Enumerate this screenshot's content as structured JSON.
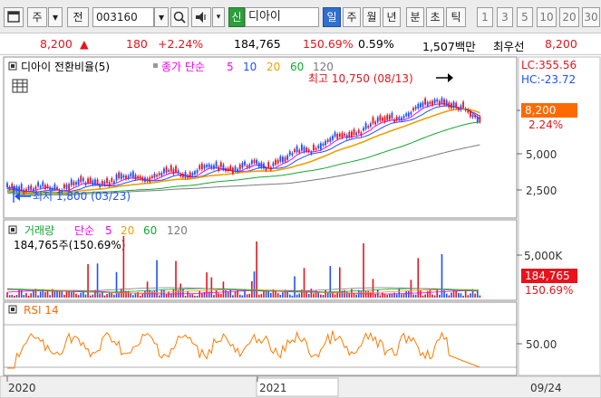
{
  "toolbar": {
    "period": "주",
    "type_label": "전",
    "code": "003160",
    "market_badge": "신",
    "stock_name": "디아이",
    "period_tabs": [
      "일",
      "주",
      "월",
      "년",
      "분",
      "초",
      "틱"
    ],
    "active_tab": "일",
    "num_tabs": [
      "1",
      "3",
      "5",
      "10",
      "20",
      "30"
    ]
  },
  "quote": {
    "price": "8,200",
    "direction": "▲",
    "change": "180",
    "change_pct": "+2.24%",
    "volume": "184,765",
    "volume_ratio": "150.69%",
    "turnover": "0.59%",
    "amount": "1,507백만",
    "tag": "최우선",
    "tag_price": "8,200"
  },
  "price_panel": {
    "title": "디아이 전환비율(5)",
    "ma_label": "종가 단순",
    "ma_periods": [
      "5",
      "10",
      "20",
      "60",
      "120"
    ],
    "ma_colors": [
      "#ff00ff",
      "#1e4fff",
      "#f0a000",
      "#12a830",
      "#7a7a7a"
    ],
    "lc": "LC:355.56",
    "hc": "HC:-23.72",
    "price_tag": "8,200",
    "pct_tag": "2.24%",
    "axis_ticks": [
      "5,000",
      "2,500"
    ],
    "high_note": "최고 10,750 (08/13)",
    "low_note": "최저 1,800 (03/23)"
  },
  "volume_panel": {
    "title": "거래량",
    "ma_label": "단순",
    "ma_periods": [
      "5",
      "20",
      "60",
      "120"
    ],
    "ma_colors": [
      "#ff00ff",
      "#f0a000",
      "#12a830",
      "#7a7a7a"
    ],
    "value_line": "184,765주(150.69%)",
    "axis_tick": "5,000K",
    "tag_value": "184,765",
    "tag_pct": "150.69%"
  },
  "rsi_panel": {
    "title": "RSI 14",
    "axis_tick": "50.00"
  },
  "time_axis": {
    "labels": [
      "2020",
      "2021"
    ],
    "date": "09/24"
  },
  "colors": {
    "up": "#e8131b",
    "down": "#1e4fff",
    "tag_orange": "#ff6a00",
    "tag_red": "#e8131b"
  }
}
